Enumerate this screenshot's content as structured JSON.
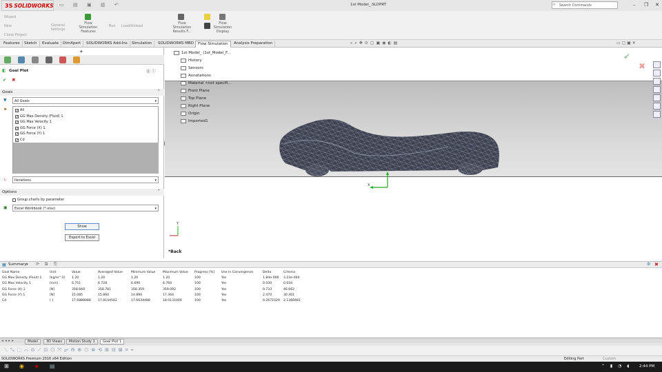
{
  "app": {
    "brand_ds": "3S",
    "brand_name": "SOLIDWORKS",
    "document_title": "1st Model_.SLDPRT",
    "search_placeholder": "Search Commands",
    "window_controls": {
      "minimize": "–",
      "restore": "❐",
      "close": "✕"
    }
  },
  "ribbon": {
    "wizard": "Wizard",
    "new": "New",
    "clone_project": "Clone Project",
    "general_settings": "General Settings",
    "flow_sim_features": "Flow Simulation Features",
    "run": "Run",
    "load_unload": "Load/Unload",
    "flow_sim_results": "Flow Simulation Results F...",
    "flow_sim_display": "Flow Simulation Display"
  },
  "tabs": [
    {
      "label": "Features"
    },
    {
      "label": "Sketch"
    },
    {
      "label": "Evaluate"
    },
    {
      "label": "DimXpert"
    },
    {
      "label": "SOLIDWORKS Add-Ins"
    },
    {
      "label": "Simulation"
    },
    {
      "label": "SOLIDWORKS MBD"
    },
    {
      "label": "Flow Simulation"
    },
    {
      "label": "Analysis Preparation"
    }
  ],
  "goal_plot": {
    "title": "Goal Plot",
    "goals_header": "Goals",
    "filter_value": "All Goals",
    "goals": [
      {
        "label": "All",
        "checked": true
      },
      {
        "label": "GG Max Density (Fluid) 1",
        "checked": true
      },
      {
        "label": "GG Max Velocity 1",
        "checked": true
      },
      {
        "label": "GG Force (X) 1",
        "checked": true
      },
      {
        "label": "GG Force (Y) 1",
        "checked": true
      },
      {
        "label": "Cd",
        "checked": true
      }
    ],
    "x_axis_value": "Iterations",
    "options_header": "Options",
    "group_charts_label": "Group charts by parameter",
    "output_format": "Excel Workbook (*.xlsx)",
    "show_button": "Show",
    "export_button": "Export to Excel"
  },
  "feature_tree": [
    {
      "label": "1st Model_ (1st_Model_F..."
    },
    {
      "label": "History"
    },
    {
      "label": "Sensors"
    },
    {
      "label": "Annotations"
    },
    {
      "label": "Material <not specifi..."
    },
    {
      "label": "Front Plane"
    },
    {
      "label": "Top Plane"
    },
    {
      "label": "Right Plane"
    },
    {
      "label": "Origin"
    },
    {
      "label": "Imported1"
    }
  ],
  "viewport": {
    "view_label": "*Back",
    "axis_x": "X",
    "axis_y": "Y"
  },
  "summary": {
    "label": "Summary",
    "columns": [
      "Goal Name",
      "Unit",
      "Value",
      "Averaged Value",
      "Minimum Value",
      "Maximum Value",
      "Progress [%]",
      "Use In Convergence",
      "Delta",
      "Criteria"
    ],
    "rows": [
      [
        "GG Max Density (Fluid) 1",
        "[kg/m^3]",
        "1.20",
        "1.20",
        "1.20",
        "1.20",
        "100",
        "Yes",
        "1.84e-006",
        "3.23e-004"
      ],
      [
        "GG Max Velocity 1",
        "[m/s]",
        "6.751",
        "6.728",
        "6.690",
        "6.760",
        "100",
        "Yes",
        "0.030",
        "0.034"
      ],
      [
        "GG Force (X) 1",
        "[N]",
        "358.660",
        "358.781",
        "358.359",
        "359.092",
        "100",
        "Yes",
        "0.733",
        "46.662"
      ],
      [
        "GG Force (Y) 1",
        "[N]",
        "15.085",
        "15.864",
        "14.894",
        "17.364",
        "100",
        "Yes",
        "2.470",
        "30.401"
      ],
      [
        "Cd",
        "[ ]",
        "17.6888088",
        "17.8144542",
        "17.6634488",
        "18.0131006",
        "100",
        "Yes",
        "0.2671029",
        "2.1366681"
      ]
    ]
  },
  "bottom_tabs": [
    {
      "label": "Model"
    },
    {
      "label": "3D Views"
    },
    {
      "label": "Motion Study 1"
    },
    {
      "label": "Goal Plot 1"
    }
  ],
  "status": {
    "edition": "SOLIDWORKS Premium 2016 x64 Edition",
    "mode": "Editing Part",
    "units": "Custom"
  },
  "taskbar": {
    "time": "2:44 PM"
  }
}
